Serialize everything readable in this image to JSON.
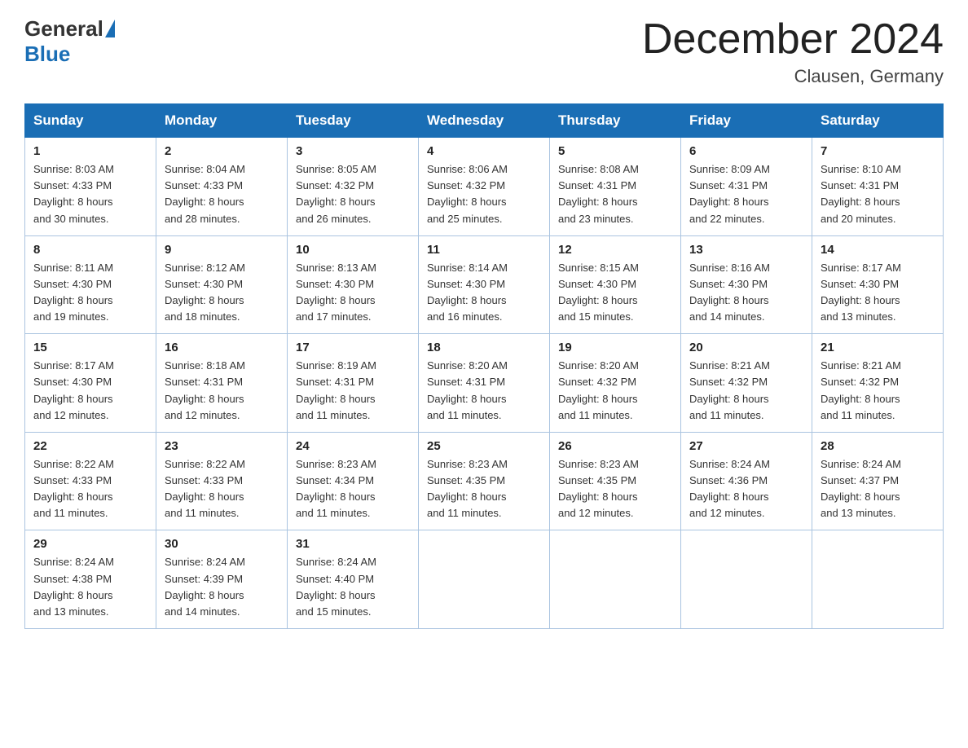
{
  "header": {
    "logo_general": "General",
    "logo_blue": "Blue",
    "month_title": "December 2024",
    "location": "Clausen, Germany"
  },
  "days_of_week": [
    "Sunday",
    "Monday",
    "Tuesday",
    "Wednesday",
    "Thursday",
    "Friday",
    "Saturday"
  ],
  "weeks": [
    [
      {
        "day": "1",
        "sunrise": "8:03 AM",
        "sunset": "4:33 PM",
        "daylight": "8 hours and 30 minutes."
      },
      {
        "day": "2",
        "sunrise": "8:04 AM",
        "sunset": "4:33 PM",
        "daylight": "8 hours and 28 minutes."
      },
      {
        "day": "3",
        "sunrise": "8:05 AM",
        "sunset": "4:32 PM",
        "daylight": "8 hours and 26 minutes."
      },
      {
        "day": "4",
        "sunrise": "8:06 AM",
        "sunset": "4:32 PM",
        "daylight": "8 hours and 25 minutes."
      },
      {
        "day": "5",
        "sunrise": "8:08 AM",
        "sunset": "4:31 PM",
        "daylight": "8 hours and 23 minutes."
      },
      {
        "day": "6",
        "sunrise": "8:09 AM",
        "sunset": "4:31 PM",
        "daylight": "8 hours and 22 minutes."
      },
      {
        "day": "7",
        "sunrise": "8:10 AM",
        "sunset": "4:31 PM",
        "daylight": "8 hours and 20 minutes."
      }
    ],
    [
      {
        "day": "8",
        "sunrise": "8:11 AM",
        "sunset": "4:30 PM",
        "daylight": "8 hours and 19 minutes."
      },
      {
        "day": "9",
        "sunrise": "8:12 AM",
        "sunset": "4:30 PM",
        "daylight": "8 hours and 18 minutes."
      },
      {
        "day": "10",
        "sunrise": "8:13 AM",
        "sunset": "4:30 PM",
        "daylight": "8 hours and 17 minutes."
      },
      {
        "day": "11",
        "sunrise": "8:14 AM",
        "sunset": "4:30 PM",
        "daylight": "8 hours and 16 minutes."
      },
      {
        "day": "12",
        "sunrise": "8:15 AM",
        "sunset": "4:30 PM",
        "daylight": "8 hours and 15 minutes."
      },
      {
        "day": "13",
        "sunrise": "8:16 AM",
        "sunset": "4:30 PM",
        "daylight": "8 hours and 14 minutes."
      },
      {
        "day": "14",
        "sunrise": "8:17 AM",
        "sunset": "4:30 PM",
        "daylight": "8 hours and 13 minutes."
      }
    ],
    [
      {
        "day": "15",
        "sunrise": "8:17 AM",
        "sunset": "4:30 PM",
        "daylight": "8 hours and 12 minutes."
      },
      {
        "day": "16",
        "sunrise": "8:18 AM",
        "sunset": "4:31 PM",
        "daylight": "8 hours and 12 minutes."
      },
      {
        "day": "17",
        "sunrise": "8:19 AM",
        "sunset": "4:31 PM",
        "daylight": "8 hours and 11 minutes."
      },
      {
        "day": "18",
        "sunrise": "8:20 AM",
        "sunset": "4:31 PM",
        "daylight": "8 hours and 11 minutes."
      },
      {
        "day": "19",
        "sunrise": "8:20 AM",
        "sunset": "4:32 PM",
        "daylight": "8 hours and 11 minutes."
      },
      {
        "day": "20",
        "sunrise": "8:21 AM",
        "sunset": "4:32 PM",
        "daylight": "8 hours and 11 minutes."
      },
      {
        "day": "21",
        "sunrise": "8:21 AM",
        "sunset": "4:32 PM",
        "daylight": "8 hours and 11 minutes."
      }
    ],
    [
      {
        "day": "22",
        "sunrise": "8:22 AM",
        "sunset": "4:33 PM",
        "daylight": "8 hours and 11 minutes."
      },
      {
        "day": "23",
        "sunrise": "8:22 AM",
        "sunset": "4:33 PM",
        "daylight": "8 hours and 11 minutes."
      },
      {
        "day": "24",
        "sunrise": "8:23 AM",
        "sunset": "4:34 PM",
        "daylight": "8 hours and 11 minutes."
      },
      {
        "day": "25",
        "sunrise": "8:23 AM",
        "sunset": "4:35 PM",
        "daylight": "8 hours and 11 minutes."
      },
      {
        "day": "26",
        "sunrise": "8:23 AM",
        "sunset": "4:35 PM",
        "daylight": "8 hours and 12 minutes."
      },
      {
        "day": "27",
        "sunrise": "8:24 AM",
        "sunset": "4:36 PM",
        "daylight": "8 hours and 12 minutes."
      },
      {
        "day": "28",
        "sunrise": "8:24 AM",
        "sunset": "4:37 PM",
        "daylight": "8 hours and 13 minutes."
      }
    ],
    [
      {
        "day": "29",
        "sunrise": "8:24 AM",
        "sunset": "4:38 PM",
        "daylight": "8 hours and 13 minutes."
      },
      {
        "day": "30",
        "sunrise": "8:24 AM",
        "sunset": "4:39 PM",
        "daylight": "8 hours and 14 minutes."
      },
      {
        "day": "31",
        "sunrise": "8:24 AM",
        "sunset": "4:40 PM",
        "daylight": "8 hours and 15 minutes."
      },
      null,
      null,
      null,
      null
    ]
  ],
  "labels": {
    "sunrise": "Sunrise:",
    "sunset": "Sunset:",
    "daylight": "Daylight:"
  }
}
